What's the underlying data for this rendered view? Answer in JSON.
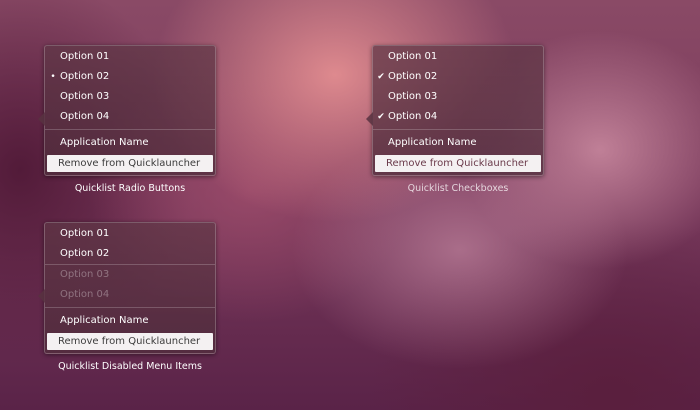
{
  "radio_menu": {
    "items": [
      {
        "label": "Option 01",
        "mark": ""
      },
      {
        "label": "Option 02",
        "mark": "•"
      },
      {
        "label": "Option 03",
        "mark": ""
      },
      {
        "label": "Option 04",
        "mark": ""
      }
    ],
    "app_name": "Application Name",
    "remove_label": "Remove from Quicklauncher",
    "caption": "Quicklist Radio Buttons"
  },
  "checkbox_menu": {
    "items": [
      {
        "label": "Option 01",
        "mark": ""
      },
      {
        "label": "Option 02",
        "mark": "✔"
      },
      {
        "label": "Option 03",
        "mark": ""
      },
      {
        "label": "Option 04",
        "mark": "✔"
      }
    ],
    "app_name": "Application Name",
    "remove_label": "Remove from Quicklauncher",
    "caption": "Quicklist Checkboxes"
  },
  "disabled_menu": {
    "items": [
      {
        "label": "Option 01",
        "disabled": false
      },
      {
        "label": "Option 02",
        "disabled": false
      },
      {
        "label": "Option 03",
        "disabled": true
      },
      {
        "label": "Option 04",
        "disabled": true
      }
    ],
    "app_name": "Application Name",
    "remove_label": "Remove from Quicklauncher",
    "caption": "Quicklist Disabled Menu Items"
  },
  "icons": {
    "radio_mark": "radio-dot-icon",
    "check_mark": "checkmark-icon",
    "pointer": "menu-pointer-arrow"
  }
}
